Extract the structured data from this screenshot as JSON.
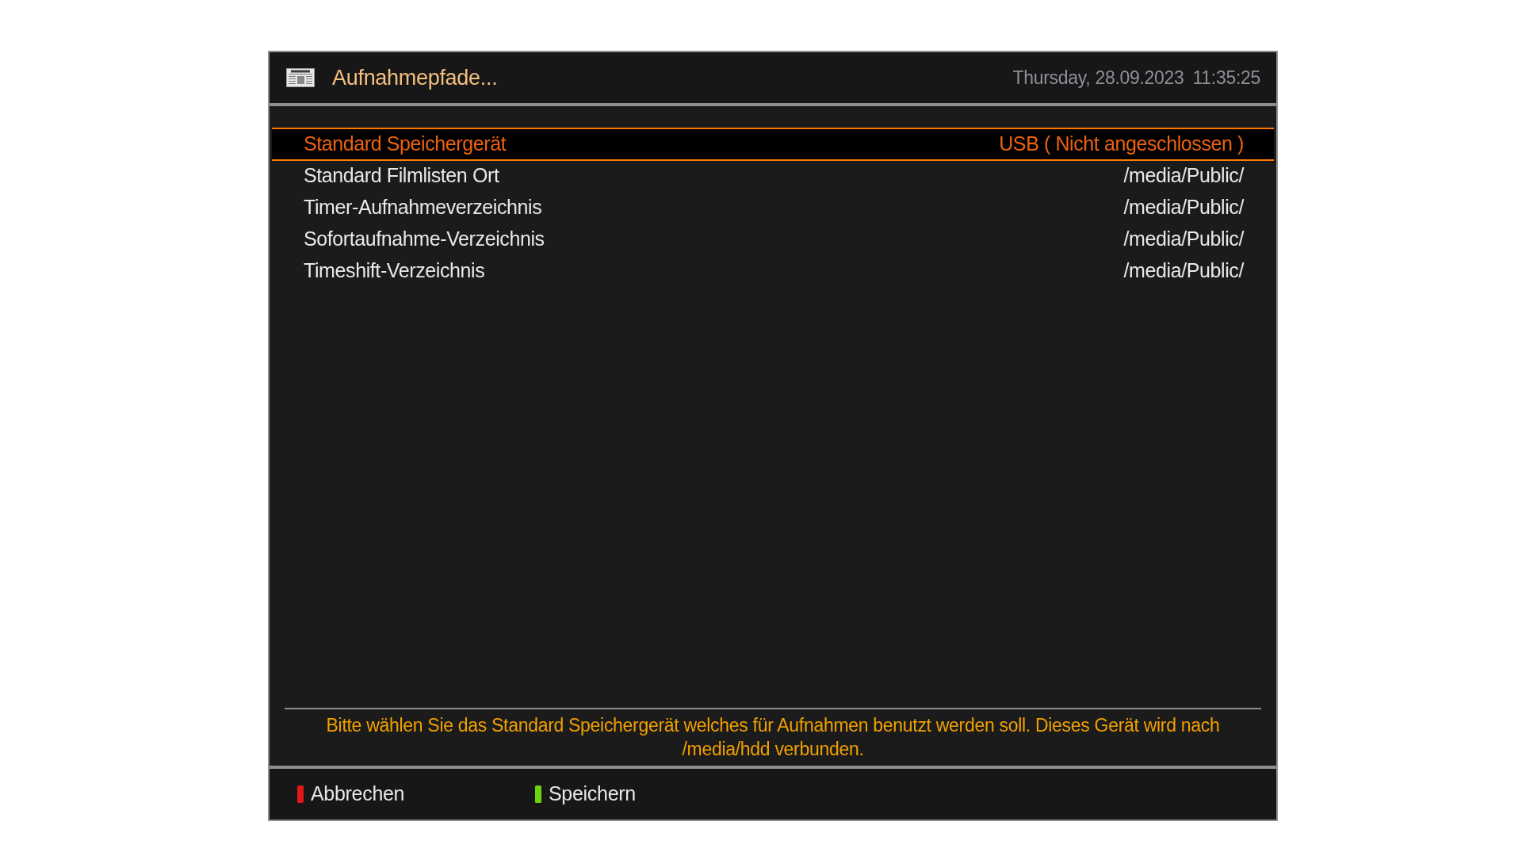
{
  "header": {
    "title": "Aufnahmepfade...",
    "date": "Thursday, 28.09.2023",
    "time": "11:35:25"
  },
  "settings": [
    {
      "label": "Standard Speichergerät",
      "value": "USB ( Nicht angeschlossen )",
      "selected": true
    },
    {
      "label": "Standard Filmlisten Ort",
      "value": "/media/Public/",
      "selected": false
    },
    {
      "label": "Timer-Aufnahmeverzeichnis",
      "value": "/media/Public/",
      "selected": false
    },
    {
      "label": "Sofortaufnahme-Verzeichnis",
      "value": "/media/Public/",
      "selected": false
    },
    {
      "label": "Timeshift-Verzeichnis",
      "value": "/media/Public/",
      "selected": false
    }
  ],
  "description": "Bitte wählen Sie das Standard Speichergerät welches für Aufnahmen benutzt werden soll. Dieses Gerät wird nach /media/hdd verbunden.",
  "buttons": [
    {
      "label": "Abbrechen",
      "color": "#e01818"
    },
    {
      "label": "Speichern",
      "color": "#6cd40e"
    }
  ]
}
